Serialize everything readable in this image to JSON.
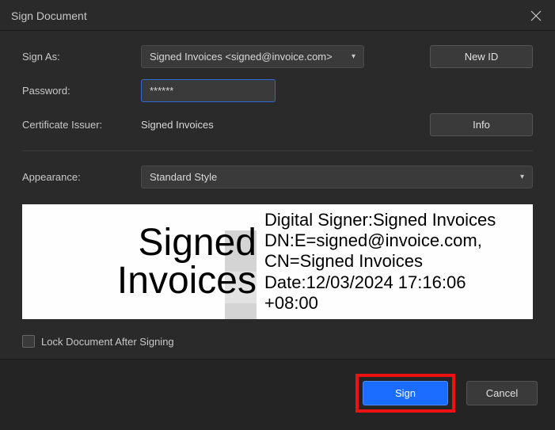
{
  "dialog": {
    "title": "Sign Document"
  },
  "labels": {
    "sign_as": "Sign As:",
    "password": "Password:",
    "certificate_issuer": "Certificate Issuer:",
    "appearance": "Appearance:",
    "lock_after": "Lock Document After Signing"
  },
  "fields": {
    "sign_as_value": "Signed Invoices <signed@invoice.com>",
    "password_value": "******",
    "certificate_issuer_value": "Signed Invoices",
    "appearance_value": "Standard Style"
  },
  "buttons": {
    "new_id": "New ID",
    "info": "Info",
    "sign": "Sign",
    "cancel": "Cancel"
  },
  "preview": {
    "name_line1": "Signed",
    "name_line2": "Invoices",
    "details_line1": "Digital Signer:Signed Invoices",
    "details_line2": "DN:E=signed@invoice.com,",
    "details_line3": "CN=Signed Invoices",
    "details_line4": "Date:12/03/2024 17:16:06",
    "details_line5": "+08:00"
  }
}
